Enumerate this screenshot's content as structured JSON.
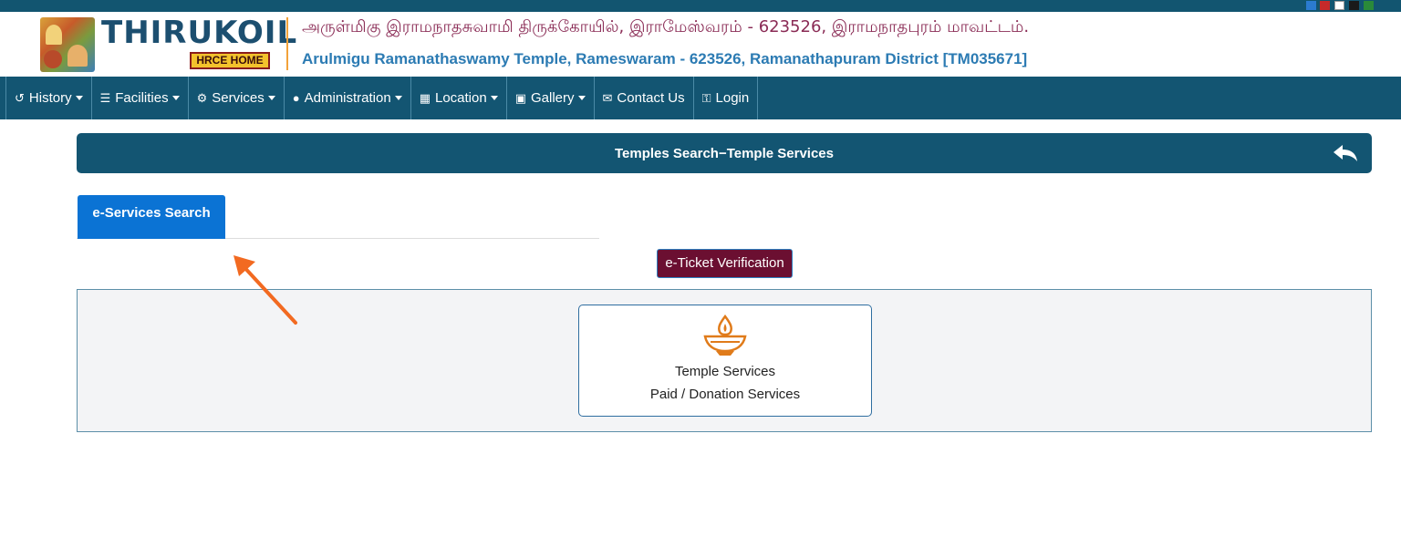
{
  "site": {
    "logo_text": "THIRUKOIL",
    "logo_badge": "HRCE HOME",
    "temple_name_tamil": "அருள்மிகு இராமநாதசுவாமி திருக்கோயில், இராமேஸ்வரம் - 623526, இராமநாதபுரம் மாவட்டம்.",
    "temple_name_english": "Arulmigu Ramanathaswamy Temple, Rameswaram - 623526, Ramanathapuram District [TM035671]"
  },
  "nav": {
    "items": [
      {
        "label": "History",
        "icon": "history-icon",
        "dropdown": true
      },
      {
        "label": "Facilities",
        "icon": "list-icon",
        "dropdown": true
      },
      {
        "label": "Services",
        "icon": "gears-icon",
        "dropdown": true
      },
      {
        "label": "Administration",
        "icon": "user-icon",
        "dropdown": true
      },
      {
        "label": "Location",
        "icon": "map-icon",
        "dropdown": true
      },
      {
        "label": "Gallery",
        "icon": "image-icon",
        "dropdown": true
      },
      {
        "label": "Contact Us",
        "icon": "envelope-icon",
        "dropdown": false
      },
      {
        "label": "Login",
        "icon": "key-icon",
        "dropdown": false
      }
    ]
  },
  "page": {
    "title": "Temples Search−Temple Services",
    "back_icon": "reply-arrow-icon"
  },
  "tabs": {
    "active_label": "e-Services Search"
  },
  "eticket": {
    "button_label": "e-Ticket Verification"
  },
  "service_card": {
    "icon": "oil-lamp-icon",
    "title": "Temple Services",
    "subtitle": "Paid / Donation Services"
  },
  "colors": {
    "navbar": "#135572",
    "tab_active": "#0b73d4",
    "eticket_button": "#6b0f31",
    "annotation_arrow": "#f26a21",
    "lamp": "#e07b1a"
  }
}
